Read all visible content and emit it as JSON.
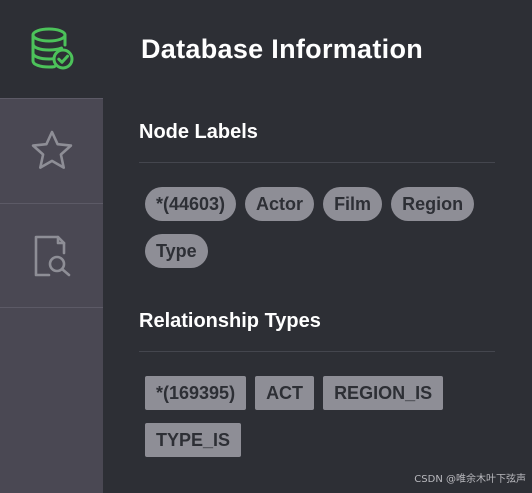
{
  "sidebar": {
    "items": [
      {
        "icon": "database-check-icon",
        "color": "#4cc25a",
        "active": true
      },
      {
        "icon": "star-icon",
        "color": "#8e8e96",
        "active": false
      },
      {
        "icon": "document-search-icon",
        "color": "#8e8e96",
        "active": false
      }
    ]
  },
  "main": {
    "title": "Database Information",
    "node_labels": {
      "heading": "Node Labels",
      "items": [
        "*(44603)",
        "Actor",
        "Film",
        "Region",
        "Type"
      ]
    },
    "relationship_types": {
      "heading": "Relationship Types",
      "items": [
        "*(169395)",
        "ACT",
        "REGION_IS",
        "TYPE_IS"
      ]
    }
  },
  "watermark": "CSDN @唯余木叶下弦声"
}
